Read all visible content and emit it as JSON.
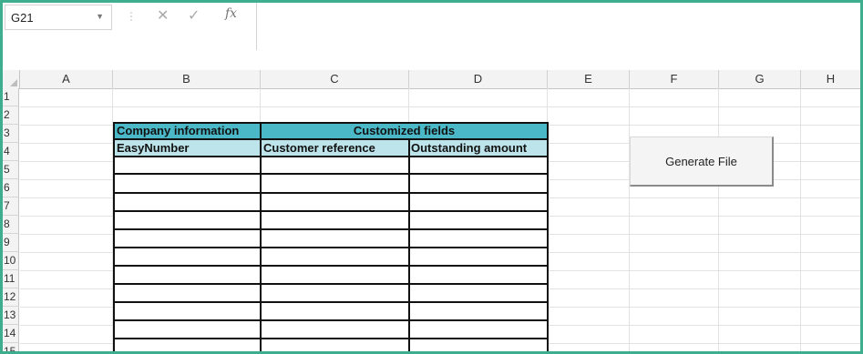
{
  "formula_bar": {
    "name_box": "G21",
    "name_box_dropdown_icon": "chevron-down-icon",
    "cancel_icon": "close-icon",
    "enter_icon": "check-icon",
    "fx_label": "fx",
    "formula_value": ""
  },
  "columns": [
    "A",
    "B",
    "C",
    "D",
    "E",
    "F",
    "G",
    "H"
  ],
  "rows": [
    "1",
    "2",
    "3",
    "4",
    "5",
    "6",
    "7",
    "8",
    "9",
    "10",
    "11",
    "12",
    "13",
    "14",
    "15"
  ],
  "table": {
    "group_company": "Company information",
    "group_custom": "Customized fields",
    "col_easy": "EasyNumber",
    "col_customer_ref": "Customer reference",
    "col_outstanding": "Outstanding amount"
  },
  "button": {
    "generate": "Generate File"
  },
  "colors": {
    "header_dark": "#4bb8c7",
    "header_light": "#bde4ea",
    "frame": "#3fae8f"
  }
}
